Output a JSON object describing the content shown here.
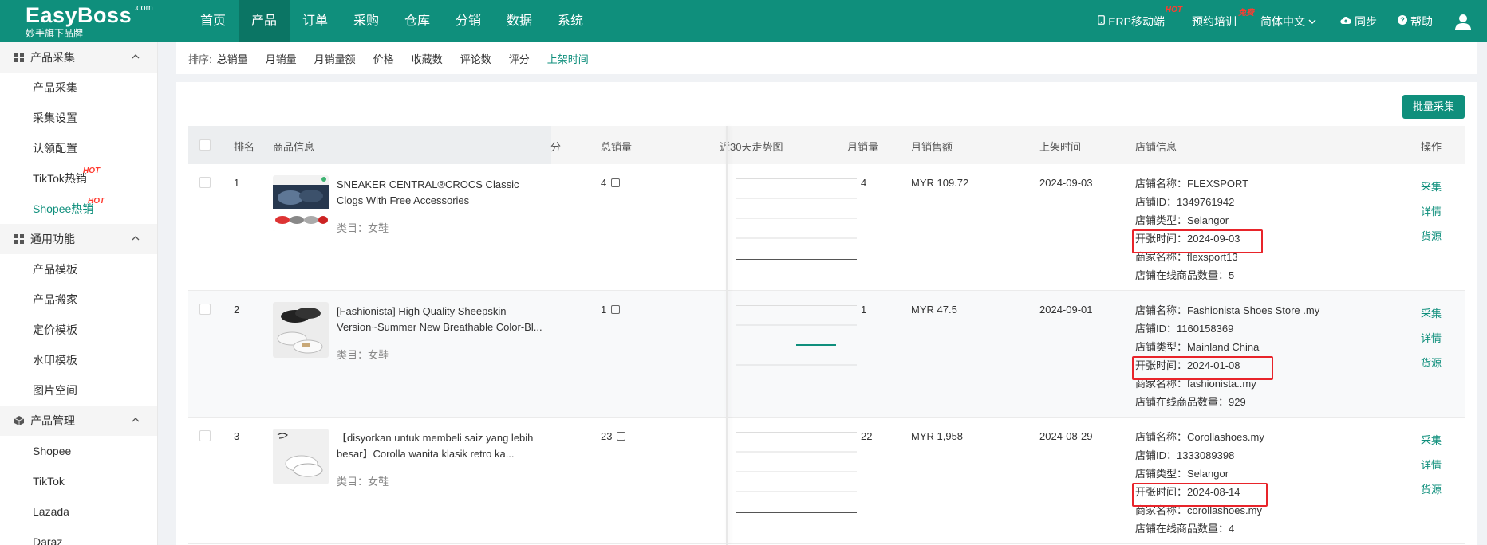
{
  "brand": {
    "name": "EasyBoss",
    "com": ".com",
    "sub": "妙手旗下品牌"
  },
  "nav": [
    "首页",
    "产品",
    "订单",
    "采购",
    "仓库",
    "分销",
    "数据",
    "系统"
  ],
  "right_nav": {
    "erp": "ERP移动端",
    "erp_tag": "HOT",
    "training": "预约培训",
    "training_tag": "免费",
    "lang": "简体中文",
    "sync": "同步",
    "help": "帮助"
  },
  "sidebar": {
    "groups": [
      {
        "title": "产品采集",
        "items": [
          {
            "label": "产品采集"
          },
          {
            "label": "采集设置"
          },
          {
            "label": "认领配置"
          },
          {
            "label": "TikTok热销",
            "tag": "HOT"
          },
          {
            "label": "Shopee热销",
            "tag": "HOT",
            "active": true
          }
        ]
      },
      {
        "title": "通用功能",
        "items": [
          {
            "label": "产品模板"
          },
          {
            "label": "产品搬家"
          },
          {
            "label": "定价模板"
          },
          {
            "label": "水印模板"
          },
          {
            "label": "图片空间"
          }
        ]
      },
      {
        "title": "产品管理",
        "items": [
          {
            "label": "Shopee"
          },
          {
            "label": "TikTok"
          },
          {
            "label": "Lazada"
          },
          {
            "label": "Daraz"
          }
        ]
      }
    ]
  },
  "sort": {
    "label": "排序:",
    "options": [
      "总销量",
      "月销量",
      "月销量额",
      "价格",
      "收藏数",
      "评论数",
      "评分",
      "上架时间"
    ],
    "active": "上架时间"
  },
  "batch_button": "批量采集",
  "table": {
    "headers": {
      "rank": "排名",
      "info": "商品信息",
      "partial": "分",
      "total_sales": "总销量",
      "trend": "近30天走势图",
      "monthly": "月销量",
      "monthly_amount": "月销售额",
      "listed": "上架时间",
      "store": "店铺信息",
      "ops": "操作"
    },
    "category_label": "类目：",
    "store_labels": {
      "name": "店铺名称：",
      "id": "店铺ID：",
      "type": "店铺类型：",
      "opened": "开张时间：",
      "merchant": "商家名称：",
      "count": "店铺在线商品数量："
    },
    "ops": [
      "采集",
      "详情",
      "货源"
    ],
    "rows": [
      {
        "rank": "1",
        "name": "SNEAKER CENTRAL®CROCS Classic Clogs With Free Accessories",
        "category": "女鞋",
        "total_sales": "4",
        "monthly": "4",
        "monthly_amount": "MYR 109.72",
        "listed": "2024-09-03",
        "store_name": "FLEXSPORT",
        "store_id": "1349761942",
        "store_type": "Selangor",
        "opened": "2024-09-03",
        "merchant": "flexsport13",
        "count": "5"
      },
      {
        "rank": "2",
        "name": "[Fashionista] High Quality Sheepskin Version~Summer New Breathable Color-Bl...",
        "category": "女鞋",
        "total_sales": "1",
        "monthly": "1",
        "monthly_amount": "MYR 47.5",
        "listed": "2024-09-01",
        "store_name": "Fashionista Shoes Store .my",
        "store_id": "1160158369",
        "store_type": "Mainland China",
        "opened": "2024-01-08",
        "merchant": "fashionista..my",
        "count": "929"
      },
      {
        "rank": "3",
        "name": "【disyorkan untuk membeli saiz yang lebih besar】Corolla wanita klasik retro ka...",
        "category": "女鞋",
        "total_sales": "23",
        "monthly": "22",
        "monthly_amount": "MYR 1,958",
        "listed": "2024-08-29",
        "store_name": "Corollashoes.my",
        "store_id": "1333089398",
        "store_type": "Selangor",
        "opened": "2024-08-14",
        "merchant": "corollashoes.my",
        "count": "4"
      }
    ]
  },
  "colors": {
    "primary": "#0f8f7c",
    "highlight": "#e8242a",
    "hot": "#ff3b30"
  }
}
